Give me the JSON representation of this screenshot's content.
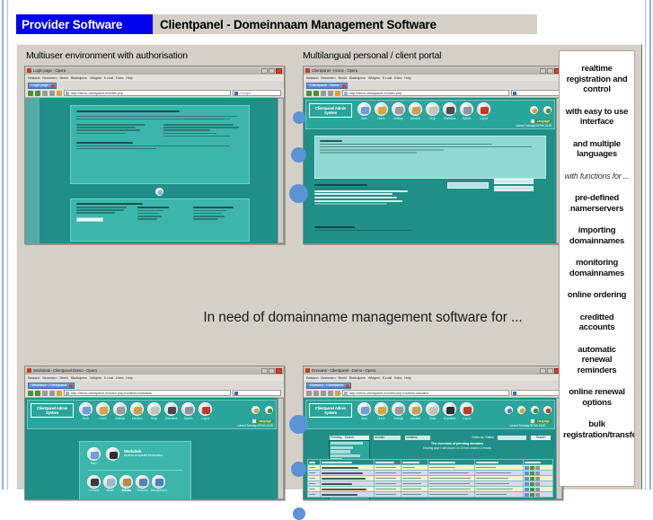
{
  "header": {
    "brand": "Provider Software",
    "title": "Clientpanel - Domeinnaam Management Software",
    "brand_color": "#0000ef",
    "band_color": "#d4d0c8"
  },
  "headline": "In need of domainname management software for ...",
  "captions": {
    "top_left": "Multiuser environment with authorisation",
    "top_right": "Multilangual personal / client portal"
  },
  "sidebar": {
    "items": [
      {
        "label": "realtime registration and control",
        "style": "bold"
      },
      {
        "label": "with easy to use interface",
        "style": "bold"
      },
      {
        "label": "and multiple languages",
        "style": "bold"
      },
      {
        "label": "with functions for ...",
        "style": "italic"
      },
      {
        "label": "pre-defined namerservers",
        "style": "bold"
      },
      {
        "label": "importing domainnames",
        "style": "bold"
      },
      {
        "label": "monitoring domainnames",
        "style": "bold"
      },
      {
        "label": "online ordering",
        "style": "bold"
      },
      {
        "label": "creditted accounts",
        "style": "bold"
      },
      {
        "label": "automatic renewal reminders",
        "style": "bold"
      },
      {
        "label": "online renewal options",
        "style": "bold"
      },
      {
        "label": "bulk registration/transfer",
        "style": "bold"
      }
    ]
  },
  "theme": {
    "teal_dark": "#1f8f87",
    "teal_mid": "#3cb5ab",
    "teal_light": "#8fd9d2",
    "dot_blue": "#5b93d6",
    "row_yellow": "#f4f3c8",
    "row_lilac": "#d9d7f0"
  },
  "windows": {
    "top_left": {
      "title": "Login page - Opera",
      "tab": "Login page",
      "url": "http://demo.clientpanel.nl/index.php",
      "search_placeholder": "Google",
      "menus": [
        "Bestand",
        "Beeld",
        "Extra",
        "Help"
      ],
      "content": {
        "heading": "Your online administration and management",
        "intro": "This is the Citrix administration module. As a customer of Citrix you can view and access information and our services online. Users of our system benefit from features as:",
        "bullets_left": [
          "extensive management options",
          "pre-paid credit accounts",
          "online dashboard payments",
          "no additional charges"
        ],
        "bullets_right": [
          "realtime registrations for any .nl to be safe natural and infra at",
          "online zone/ir helpdesk",
          "whois an Nifecure listings",
          "languages in English and Dutch"
        ],
        "subheading": "Online registration",
        "sub_text": "To obtain an access account you can register online, you will then receive your login details in a few minutes.",
        "forgot_heading": "Forgot your password ?",
        "forgot_text": "Enter your username or emailaddress below and you will receive a new password by email.",
        "buttons": [
          "Send"
        ]
      }
    },
    "top_right": {
      "title": "Clientpanel - Home - Opera",
      "tab": "Clientpanel - Home",
      "url": "http://demo.clientpanel.nl/index.php",
      "logo": "Clientpanel Admin System",
      "toolbar": [
        "Back",
        "Home",
        "Settings",
        "Interface",
        "Shop",
        "Workdesk",
        "Sysinfo",
        "Logout"
      ],
      "session": "current Tuesday 09 Feb 16:30",
      "lang_badge": "Language",
      "panels": {
        "news_title": "News:",
        "news_lines": [
          "01 april, the information about our services to promote your domainname contact sales.",
          "01 april, Realtime DNS changes for Dns hosted domainnames, search for the domainname and use the button at the bottom of the page."
        ],
        "stats_title": "Domainnames",
        "stats_lines": [
          "There are 1 pre-registered domainnames",
          "There are 40 registered domainnames",
          "There are 0 requests to confirm",
          "There are 2 sent requests",
          "There are 15 pending requests",
          "There are 4 yet-incoming requests"
        ],
        "buttons": [
          "search filters",
          "search environments"
        ],
        "financial_title": "Financial",
        "financial_line": "Your balance is EUR 0,00 for pending requests."
      }
    },
    "bottom_left": {
      "title": "Workdesk - Clientpanel Demo - Opera",
      "tab": "Workdesk - Clientpanel",
      "url": "http://demo.clientpanel.nl/index.php?content=workdesk",
      "logo": "Clientpanel Admin System",
      "toolbar": [
        "Back",
        "Home",
        "Settings",
        "Interface",
        "Shop",
        "Workdesk",
        "Sysinfo",
        "Logout"
      ],
      "session": "current Tuesday 09 Feb 16:30",
      "card_title": "Workdesk",
      "card_sub": "access or update information",
      "icon_row": [
        "Contacts",
        "Admin",
        "Articles",
        "Financial",
        "Management"
      ]
    },
    "bottom_right": {
      "title": "Domains - Clientpanel - Demo - Opera",
      "tab": "Domains - Clientpanel",
      "url": "http://demo.clientpanel.nl/index.php?content=domains",
      "logo": "Clientpanel Admin System",
      "toolbar": [
        "Back",
        "Home",
        "Settings",
        "Interface",
        "Shop",
        "Workdesk",
        "Logout"
      ],
      "session": "current Tuesday 09 Feb 16:40",
      "table_title": "The overview of pending domains",
      "table_sub": "Showing page 1 with record 1 to 10 from a total of 12 results.",
      "filter_selected": "Pending - Search",
      "filter_options": [
        "Pending - Search",
        "Whois",
        "Order",
        "Manage zones"
      ],
      "scope_selects": [
        "domain",
        "contains"
      ],
      "order_label": "Order by: Status",
      "search_button": "Search",
      "columns": [
        "#",
        "Domainname",
        "Registered",
        "Status",
        "Last action",
        "Owner",
        "Actions"
      ],
      "rows": [
        {
          "name": "hostingmy.nl",
          "date": "2009-05-30",
          "status": "New",
          "action": "Register",
          "owner": "Kurt, P"
        },
        {
          "name": "hostingdns.nl",
          "date": "2009-06-01",
          "status": "Processing",
          "action": "update nb - record - rejected",
          "owner": "Benny, Lena, DM / H. Bacalfani"
        },
        {
          "name": "hostingdnsx.nl",
          "date": "2009-06-01",
          "status": "Processing",
          "action": "update domainname record - rejected",
          "owner": "Kurt, P / MR H Bacalfani"
        },
        {
          "name": "hostbiz.nl",
          "date": "2009-06-09",
          "status": "Processing",
          "action": "update domainname record - rejected",
          "owner": "Kurt, P / MR H Bacalfani"
        },
        {
          "name": "allwebworld.nl",
          "date": "2009-06-09",
          "status": "Processing",
          "action": "update domainname record - rejected",
          "owner": "Benny, Lena, DM / H. Bacalfani"
        }
      ],
      "sidemenu": [
        "Whois order",
        "Whois",
        "Whois registered",
        "Whois zones",
        "Whoisping",
        "Whois renewals page",
        "Whois listed",
        "Whois refreshed",
        "Whois queue",
        "Picture queue"
      ]
    }
  }
}
